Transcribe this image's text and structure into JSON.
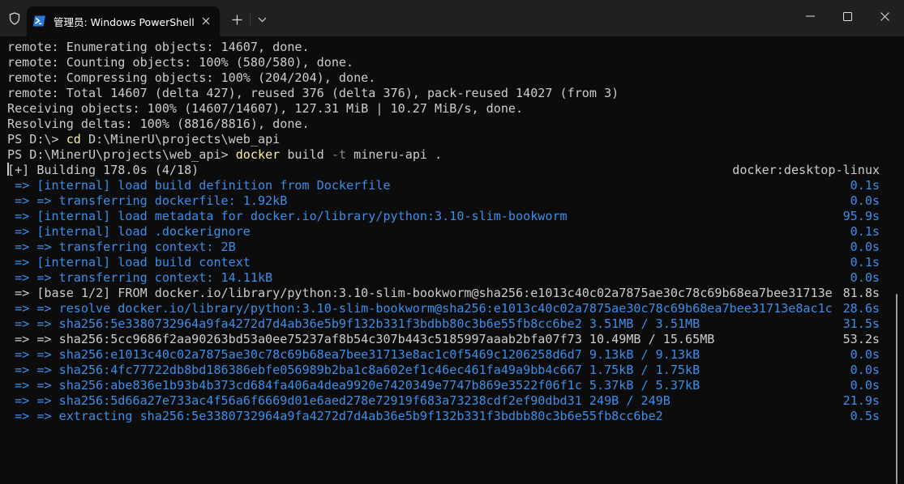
{
  "titlebar": {
    "tab_title": "管理员: Windows PowerShell",
    "icons": {
      "shield": "shield-icon",
      "app": "powershell-icon",
      "close_tab": "close-icon",
      "new_tab": "plus-icon",
      "dropdown": "chevron-down-icon",
      "minimize": "minimize-icon",
      "maximize": "maximize-icon",
      "close_window": "close-icon"
    },
    "accent": "#0078d4"
  },
  "colors": {
    "background": "#0c0c0c",
    "foreground": "#cccccc",
    "blue": "#3b8eea",
    "command": "#f9f1a5",
    "flag": "#8a8a8a"
  },
  "terminal": {
    "lines": [
      {
        "text": "remote: Enumerating objects: 14607, done."
      },
      {
        "text": "remote: Counting objects: 100% (580/580), done."
      },
      {
        "text": "remote: Compressing objects: 100% (204/204), done."
      },
      {
        "text": "remote: Total 14607 (delta 427), reused 376 (delta 376), pack-reused 14027 (from 3)"
      },
      {
        "text": "Receiving objects: 100% (14607/14607), 127.31 MiB | 10.27 MiB/s, done."
      },
      {
        "text": "Resolving deltas: 100% (8816/8816), done."
      }
    ],
    "prompt1": {
      "prompt": "PS D:\\> ",
      "cmd": "cd",
      "args": " D:\\MinerU\\projects\\web_api"
    },
    "prompt2": {
      "prompt": "PS D:\\MinerU\\projects\\web_api> ",
      "cmd": "docker",
      "args1": " build ",
      "flag": "-t",
      "args2": " mineru-api ."
    },
    "build_header": {
      "text": "[+] Building 178.0s (4/18)",
      "context": "docker:desktop-linux"
    },
    "build_steps": [
      {
        "text": " => [internal] load build definition from Dockerfile",
        "time": "0.1s",
        "color": "blue"
      },
      {
        "text": " => => transferring dockerfile: 1.92kB",
        "time": "0.0s",
        "color": "blue"
      },
      {
        "text": " => [internal] load metadata for docker.io/library/python:3.10-slim-bookworm",
        "time": "95.9s",
        "color": "blue"
      },
      {
        "text": " => [internal] load .dockerignore",
        "time": "0.1s",
        "color": "blue"
      },
      {
        "text": " => => transferring context: 2B",
        "time": "0.0s",
        "color": "blue"
      },
      {
        "text": " => [internal] load build context",
        "time": "0.1s",
        "color": "blue"
      },
      {
        "text": " => => transferring context: 14.11kB",
        "time": "0.0s",
        "color": "blue"
      },
      {
        "text": " => [base 1/2] FROM docker.io/library/python:3.10-slim-bookworm@sha256:e1013c40c02a7875ae30c78c69b68ea7bee31713e",
        "time": "81.8s",
        "color": "white"
      },
      {
        "text": " => => resolve docker.io/library/python:3.10-slim-bookworm@sha256:e1013c40c02a7875ae30c78c69b68ea7bee31713e8ac1c",
        "time": "28.6s",
        "color": "blue"
      },
      {
        "text": " => => sha256:5e3380732964a9fa4272d7d4ab36e5b9f132b331f3bdbb80c3b6e55fb8cc6be2 3.51MB / 3.51MB",
        "time": "31.5s",
        "color": "blue"
      },
      {
        "text": " => => sha256:5cc9686f2aa90263bd53a0ee75237af8b54c307b443c5185997aaab2bfa07f73 10.49MB / 15.65MB",
        "time": "53.2s",
        "color": "white"
      },
      {
        "text": " => => sha256:e1013c40c02a7875ae30c78c69b68ea7bee31713e8ac1c0f5469c1206258d6d7 9.13kB / 9.13kB",
        "time": "0.0s",
        "color": "blue"
      },
      {
        "text": " => => sha256:4fc77722db8bd186386ebfe056989b2ba1c8a602ef1c46ec461fa49a9bb4c667 1.75kB / 1.75kB",
        "time": "0.0s",
        "color": "blue"
      },
      {
        "text": " => => sha256:abe836e1b93b4b373cd684fa406a4dea9920e7420349e7747b869e3522f06f1c 5.37kB / 5.37kB",
        "time": "0.0s",
        "color": "blue"
      },
      {
        "text": " => => sha256:5d66a27e733ac4f56a6f6669d01e6aed278e72919f683a73238cdf2ef90dbd31 249B / 249B",
        "time": "21.9s",
        "color": "blue"
      },
      {
        "text": " => => extracting sha256:5e3380732964a9fa4272d7d4ab36e5b9f132b331f3bdbb80c3b6e55fb8cc6be2",
        "time": "0.5s",
        "color": "blue"
      }
    ]
  }
}
